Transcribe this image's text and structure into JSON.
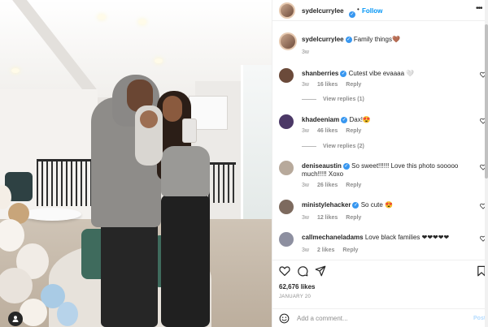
{
  "post": {
    "username": "sydelcurrylee",
    "verified": true,
    "follow_label": "Follow",
    "dot": "•",
    "more": "•••",
    "caption_text": "Family things",
    "caption_emoji": "🤎",
    "caption_time": "3w",
    "likes": "62,676 likes",
    "date": "JANUARY 20"
  },
  "comments": [
    {
      "user": "shanberries",
      "text": "Cutest vibe evaaaa 🤍",
      "time": "3w",
      "likes": "16 likes",
      "reply": "Reply",
      "view_replies": "View replies (1)",
      "avatar_color": "#6b4a3a"
    },
    {
      "user": "khadeeniam",
      "text": "Dax!😍",
      "time": "3w",
      "likes": "46 likes",
      "reply": "Reply",
      "view_replies": "View replies (2)",
      "avatar_color": "#4b3866"
    },
    {
      "user": "deniseaustin",
      "text": "So sweet!!!!!! Love this photo sooooo much!!!!! Xoxo",
      "time": "3w",
      "likes": "26 likes",
      "reply": "Reply",
      "avatar_color": "#b7a99b"
    },
    {
      "user": "ministylehacker",
      "text": "So cute 😍",
      "time": "3w",
      "likes": "12 likes",
      "reply": "Reply",
      "avatar_color": "#7d6a5e"
    },
    {
      "user": "callmechaneladams",
      "text": "Love black families ❤❤❤❤❤",
      "time": "3w",
      "likes": "2 likes",
      "reply": "Reply",
      "avatar_color": "#8d8fa0"
    }
  ],
  "add_comment": {
    "placeholder": "Add a comment...",
    "post_label": "Post"
  },
  "icons": [
    "heart-icon",
    "comment-icon",
    "share-icon",
    "bookmark-icon",
    "emoji-icon",
    "user-tag-icon",
    "more-icon",
    "verified-icon"
  ],
  "colors": {
    "link": "#0095f6",
    "verified": "#3897f0",
    "muted": "#8e8e8e",
    "text": "#262626"
  }
}
